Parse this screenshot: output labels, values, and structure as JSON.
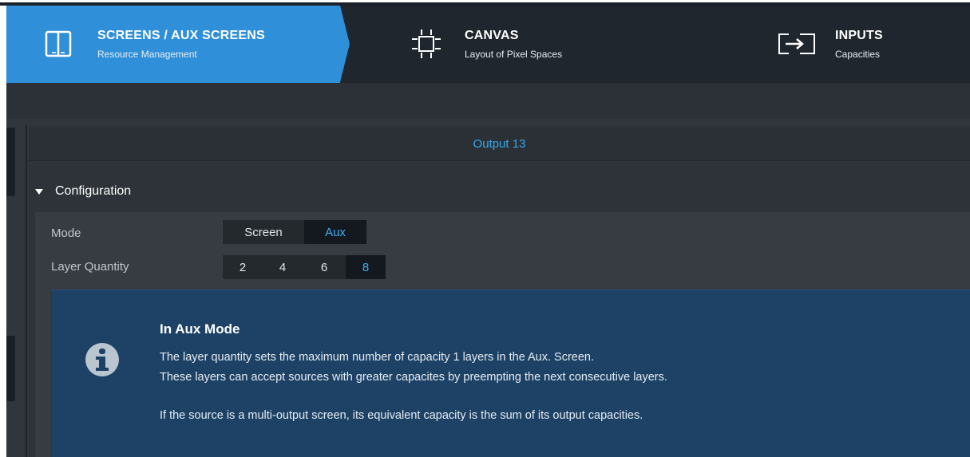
{
  "nav": {
    "tabs": [
      {
        "title": "SCREENS / AUX SCREENS",
        "subtitle": "Resource Management",
        "icon": "screens-icon",
        "active": true
      },
      {
        "title": "CANVAS",
        "subtitle": "Layout of Pixel Spaces",
        "icon": "canvas-icon",
        "active": false
      },
      {
        "title": "INPUTS",
        "subtitle": "Capacities",
        "icon": "inputs-icon",
        "active": false
      }
    ]
  },
  "output": {
    "title": "Output 13"
  },
  "configuration": {
    "section_label": "Configuration",
    "mode": {
      "label": "Mode",
      "options": [
        "Screen",
        "Aux"
      ],
      "selected": "Aux"
    },
    "layer_quantity": {
      "label": "Layer Quantity",
      "options": [
        "2",
        "4",
        "6",
        "8"
      ],
      "selected": "8"
    }
  },
  "info": {
    "icon": "info-icon",
    "title": "In Aux Mode",
    "lines": [
      "The layer quantity sets the maximum number of capacity 1 layers in the Aux. Screen.",
      "These layers can accept sources with greater capacites by preempting the next consecutive layers.",
      "If the source is a multi-output screen, its equivalent capacity is the sum of its output capacities."
    ]
  },
  "colors": {
    "accent": "#2f8fd8",
    "selected_text": "#45adef",
    "info_bg": "#1d4266",
    "nav_bg": "#1f262d"
  }
}
